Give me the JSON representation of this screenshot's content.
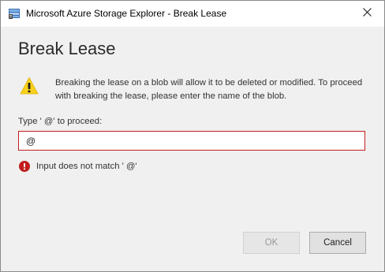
{
  "window": {
    "title": "Microsoft Azure Storage Explorer - Break Lease"
  },
  "dialog": {
    "heading": "Break Lease",
    "warning_message": "Breaking the lease on a blob will allow it to be deleted or modified. To proceed with breaking the lease, please enter the name of the blob.",
    "field_label": "Type ' @' to proceed:",
    "input_value": "@",
    "error_message": "Input does not match ' @'"
  },
  "buttons": {
    "ok_label": "OK",
    "ok_enabled": false,
    "cancel_label": "Cancel"
  },
  "icons": {
    "app": "storage-explorer-icon",
    "close": "close-icon",
    "warning": "warning-icon",
    "error": "error-icon"
  },
  "colors": {
    "warning_yellow": "#f8d11c",
    "error_red": "#c21e1e",
    "dialog_background": "#f0f0f0"
  }
}
